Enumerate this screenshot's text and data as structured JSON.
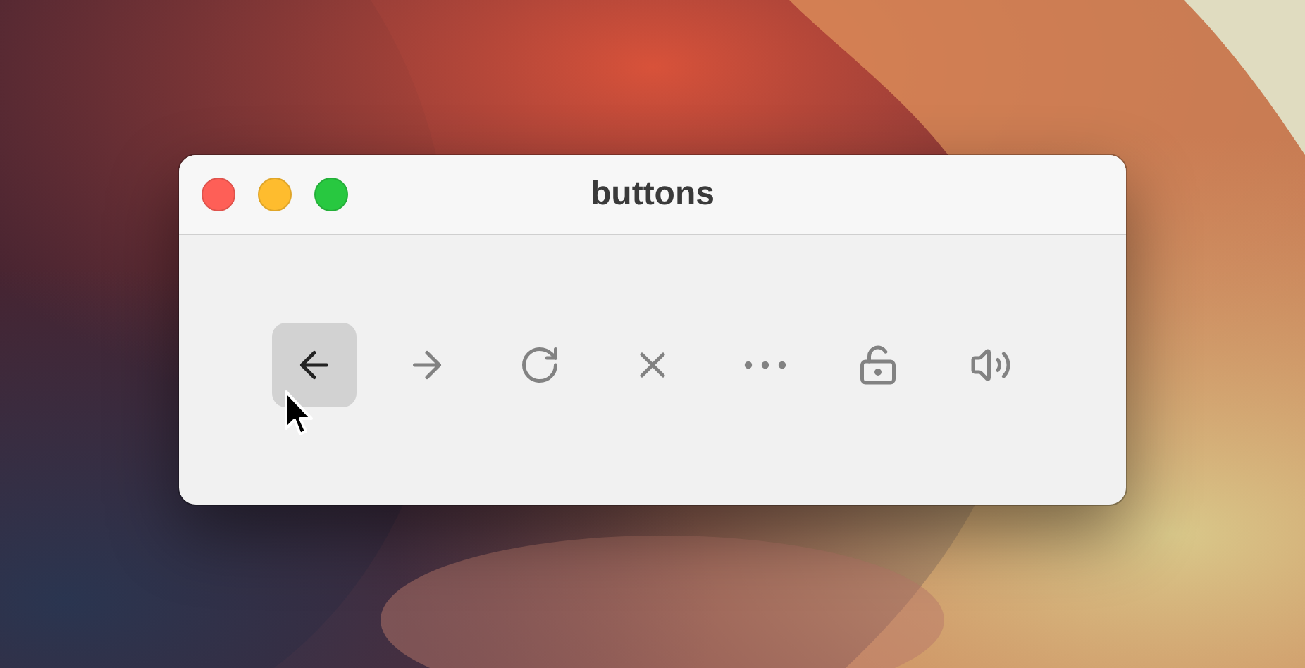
{
  "window": {
    "title": "buttons"
  },
  "buttons": [
    {
      "kind": "back",
      "highlighted": true
    },
    {
      "kind": "forward",
      "highlighted": false
    },
    {
      "kind": "reload",
      "highlighted": false
    },
    {
      "kind": "close",
      "highlighted": false
    },
    {
      "kind": "more",
      "highlighted": false
    },
    {
      "kind": "unlock",
      "highlighted": false
    },
    {
      "kind": "volume",
      "highlighted": false
    }
  ]
}
